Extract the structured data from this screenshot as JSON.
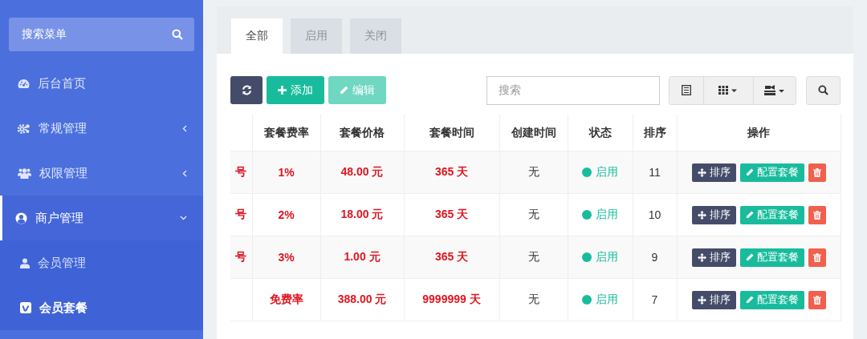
{
  "sidebar": {
    "search": {
      "placeholder": "搜索菜单"
    },
    "items": [
      {
        "label": "后台首页",
        "selected": false
      },
      {
        "label": "常规管理",
        "selected": false,
        "expanded": false
      },
      {
        "label": "权限管理",
        "selected": false,
        "expanded": false
      },
      {
        "label": "商户管理",
        "selected": true,
        "expanded": true,
        "children": [
          {
            "label": "会员管理",
            "selected": false
          },
          {
            "label": "会员套餐",
            "selected": true
          }
        ]
      }
    ]
  },
  "tabs": [
    {
      "label": "全部",
      "selected": true
    },
    {
      "label": "启用",
      "selected": false
    },
    {
      "label": "关闭",
      "selected": false
    }
  ],
  "toolbar": {
    "add_button": "添加",
    "edit_button": {
      "label": "编辑",
      "disabled": true
    },
    "search": {
      "placeholder": "搜索"
    }
  },
  "table": {
    "columns": [
      "套餐费率",
      "套餐价格",
      "套餐时间",
      "创建时间",
      "状态",
      "排序",
      "操作"
    ],
    "rows": [
      {
        "column_1": "号",
        "rate": "1%",
        "price": "48.00 元",
        "duration": "365 天",
        "created": "无",
        "status": {
          "label": "启用",
          "enabled": true
        },
        "sort": "11",
        "actions": [
          "排序",
          "配置套餐"
        ]
      },
      {
        "column_1": "号",
        "rate": "2%",
        "price": "18.00 元",
        "duration": "365 天",
        "created": "无",
        "status": {
          "label": "启用",
          "enabled": true
        },
        "sort": "10",
        "actions": [
          "排序",
          "配置套餐"
        ]
      },
      {
        "column_1": "号",
        "rate": "3%",
        "price": "1.00 元",
        "duration": "365 天",
        "created": "无",
        "status": {
          "label": "启用",
          "enabled": true
        },
        "sort": "9",
        "actions": [
          "排序",
          "配置套餐"
        ]
      },
      {
        "rate": "免费率",
        "price": "388.00 元",
        "duration": "9999999 天",
        "created": "无",
        "status": {
          "label": "启用",
          "enabled": true
        },
        "sort": "7",
        "actions": [
          "排序",
          "配置套餐"
        ]
      }
    ]
  }
}
